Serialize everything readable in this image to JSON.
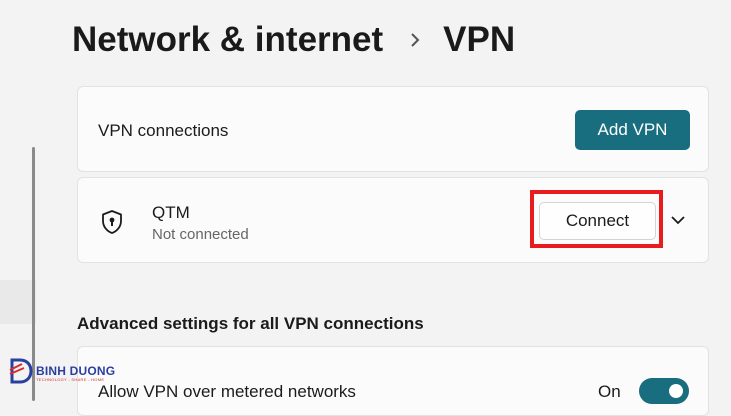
{
  "breadcrumb": {
    "parent": "Network & internet",
    "current": "VPN"
  },
  "connections": {
    "label": "VPN connections",
    "add_button": "Add VPN"
  },
  "vpn_entry": {
    "name": "QTM",
    "status": "Not connected",
    "connect_button": "Connect"
  },
  "advanced": {
    "heading": "Advanced settings for all VPN connections",
    "metered": {
      "label": "Allow VPN over metered networks",
      "state": "On"
    }
  },
  "watermark": {
    "text": "BINH DUONG",
    "subtext": "TECHNOLOGY - SHARE - HOME"
  },
  "colors": {
    "accent": "#186d7f",
    "highlight": "#e81c1c",
    "background": "#f3f3f3"
  }
}
